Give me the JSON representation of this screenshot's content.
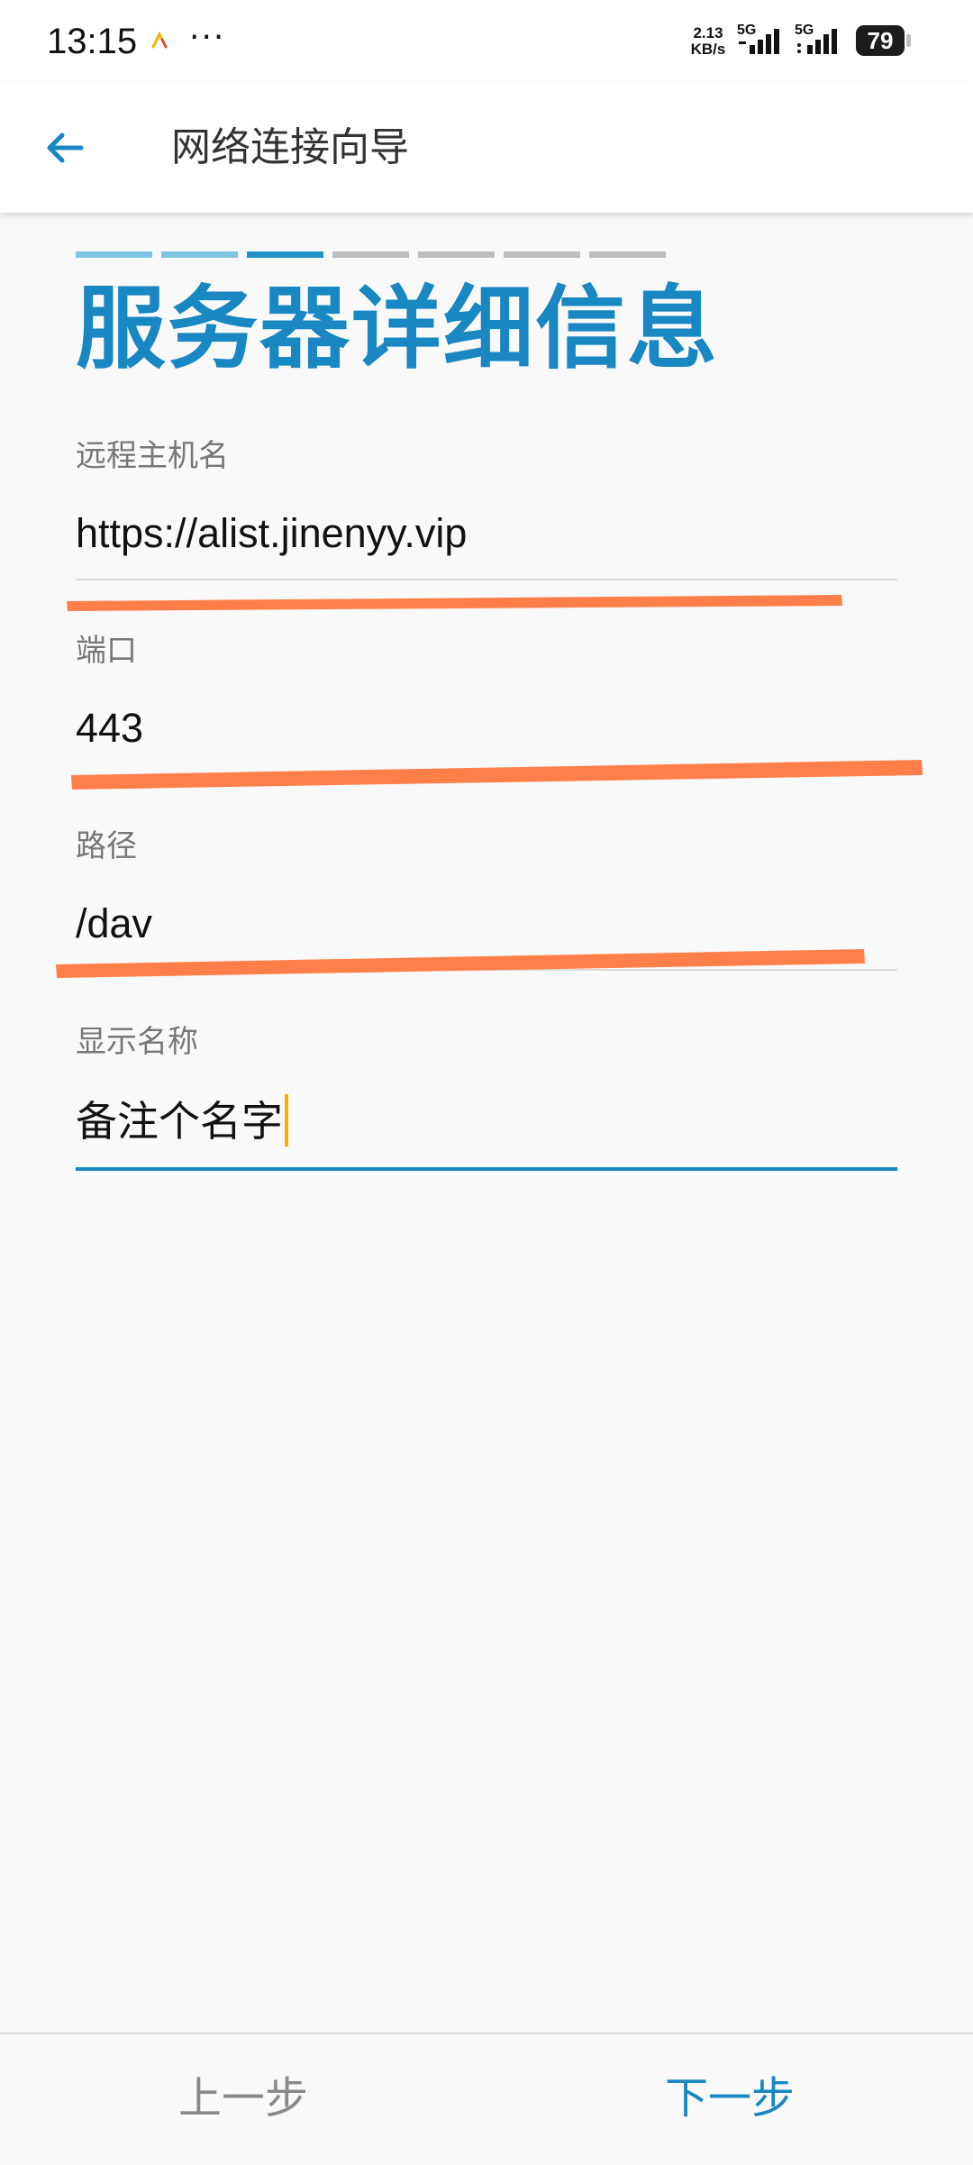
{
  "status_bar": {
    "time": "13:15",
    "more": "···",
    "net_speed_value": "2.13",
    "net_speed_unit": "KB/s",
    "signal_1_label": "5G",
    "signal_2_label": "5G",
    "battery_level": "79"
  },
  "app_bar": {
    "back_icon": "arrow-back-icon",
    "title": "网络连接向导"
  },
  "wizard": {
    "total_steps": 7,
    "current_step": 3,
    "heading": "服务器详细信息"
  },
  "form": {
    "host": {
      "label": "远程主机名",
      "value": "https://alist.jinenyy.vip"
    },
    "port": {
      "label": "端口",
      "value": "443"
    },
    "path": {
      "label": "路径",
      "value": "/dav"
    },
    "display_name": {
      "label": "显示名称",
      "value": "备注个名字"
    }
  },
  "footer": {
    "prev_label": "上一步",
    "next_label": "下一步"
  },
  "colors": {
    "accent": "#1887c2",
    "step_done": "#7fc6e3",
    "step_current": "#1f91c9",
    "step_pending": "#bdbdbd",
    "annotation_mark": "#ff7f4a",
    "cursor": "#f2b300"
  }
}
